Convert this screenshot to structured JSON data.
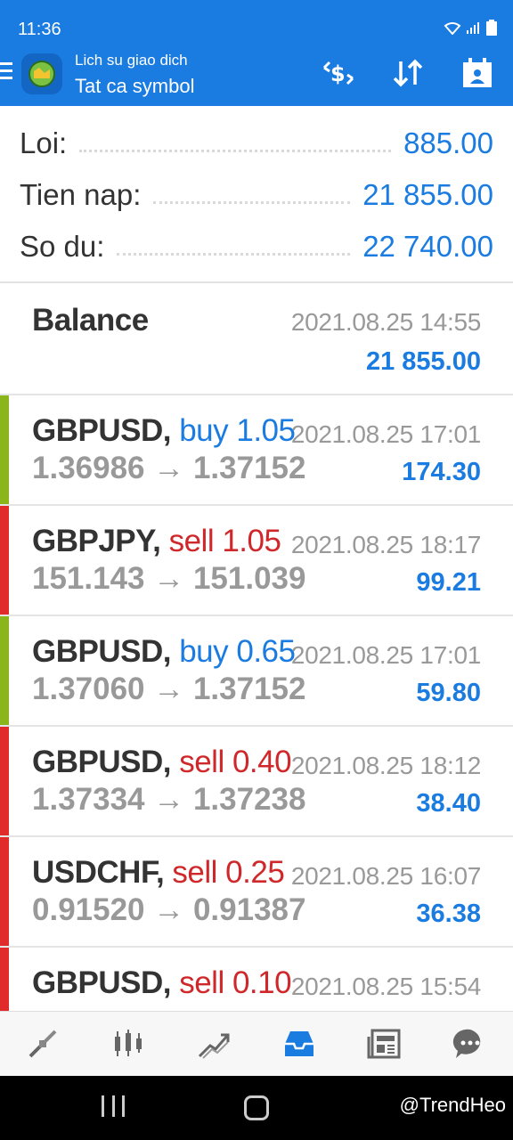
{
  "status": {
    "time": "11:36"
  },
  "header": {
    "subtitle": "Lich su giao dich",
    "title": "Tat ca symbol"
  },
  "summary": {
    "profit_label": "Loi:",
    "profit_value": "885.00",
    "deposit_label": "Tien nap:",
    "deposit_value": "21 855.00",
    "balance_label": "So du:",
    "balance_value": "22 740.00"
  },
  "balance_entry": {
    "label": "Balance",
    "time": "2021.08.25 14:55",
    "amount": "21 855.00"
  },
  "deals": [
    {
      "symbol": "GBPUSD,",
      "type": "buy 1.05",
      "side": "buy",
      "time": "2021.08.25 17:01",
      "prices": "1.36986 → 1.37152",
      "profit": "174.30"
    },
    {
      "symbol": "GBPJPY,",
      "type": "sell 1.05",
      "side": "sell",
      "time": "2021.08.25 18:17",
      "prices": "151.143 → 151.039",
      "profit": "99.21"
    },
    {
      "symbol": "GBPUSD,",
      "type": "buy 0.65",
      "side": "buy",
      "time": "2021.08.25 17:01",
      "prices": "1.37060 → 1.37152",
      "profit": "59.80"
    },
    {
      "symbol": "GBPUSD,",
      "type": "sell 0.40",
      "side": "sell",
      "time": "2021.08.25 18:12",
      "prices": "1.37334 → 1.37238",
      "profit": "38.40"
    },
    {
      "symbol": "USDCHF,",
      "type": "sell 0.25",
      "side": "sell",
      "time": "2021.08.25 16:07",
      "prices": "0.91520 → 0.91387",
      "profit": "36.38"
    },
    {
      "symbol": "GBPUSD,",
      "type": "sell 0.10",
      "side": "sell",
      "time": "2021.08.25 15:54",
      "prices": "",
      "profit": ""
    }
  ],
  "colors": {
    "accent": "#1a7be0",
    "buy": "#1a7be0",
    "sell": "#d0282a",
    "buy_bar": "#8ab61c",
    "sell_bar": "#e12b2b"
  },
  "bottom_nav": [
    "quotes-icon",
    "chart-icon",
    "trade-icon",
    "history-icon",
    "news-icon",
    "chat-icon"
  ],
  "watermark": "@TrendHeo"
}
